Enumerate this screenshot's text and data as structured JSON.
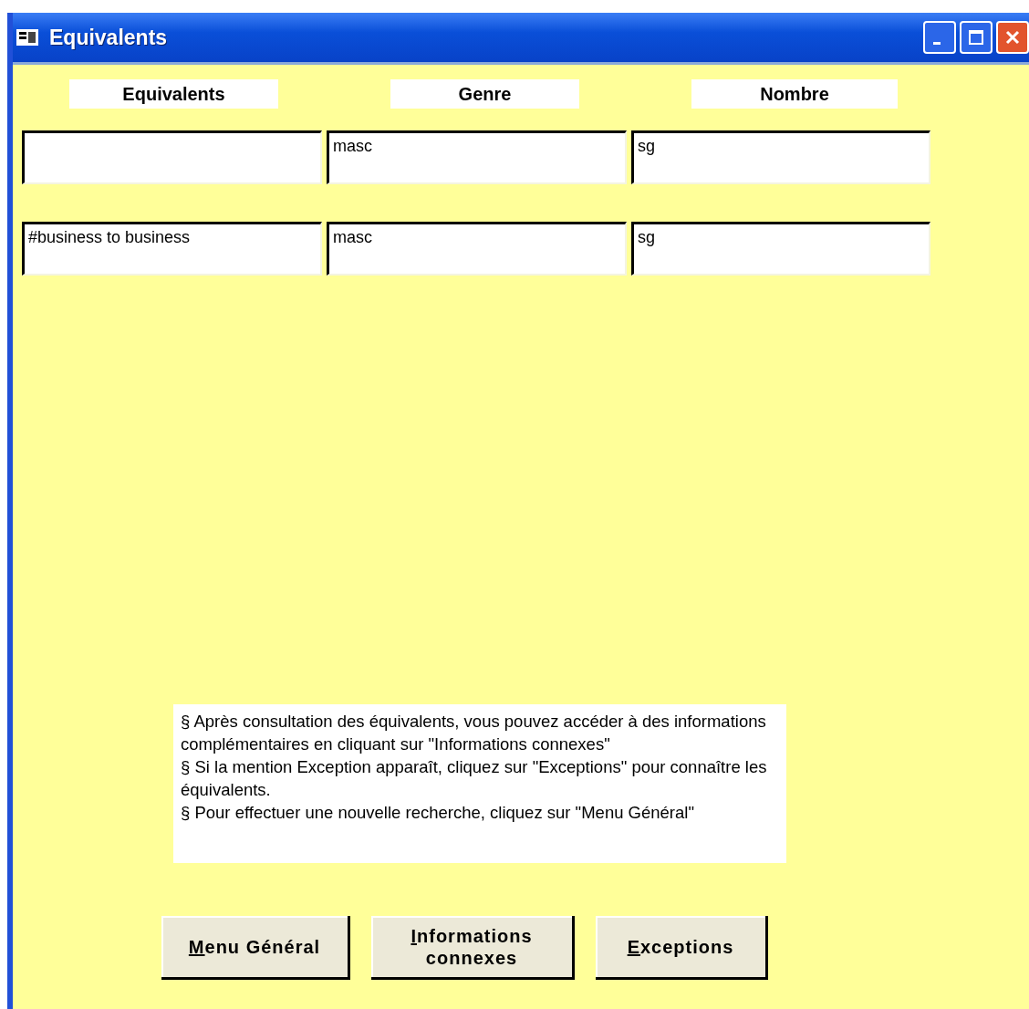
{
  "window": {
    "title": "Equivalents"
  },
  "columns": [
    "Equivalents",
    "Genre",
    "Nombre"
  ],
  "rows": [
    {
      "equivalent": "",
      "genre": "masc",
      "nombre": "sg"
    },
    {
      "equivalent": "#business to business",
      "genre": "masc",
      "nombre": "sg"
    }
  ],
  "help_text": [
    "§ Après consultation des équivalents, vous pouvez accéder à des informations complémentaires en cliquant sur \"Informations connexes\"",
    "§ Si la mention Exception apparaît, cliquez sur \"Exceptions\" pour connaître les équivalents.",
    "§ Pour effectuer une nouvelle recherche, cliquez sur \"Menu Général\""
  ],
  "buttons": [
    "Menu Général",
    "Informations connexes",
    "Exceptions"
  ]
}
